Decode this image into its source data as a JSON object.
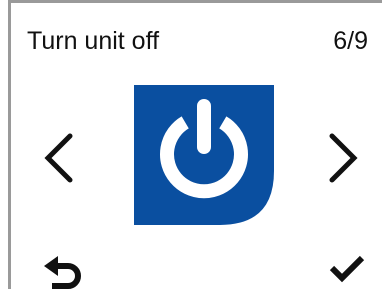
{
  "screen": {
    "title": "Turn unit off",
    "page_counter": "6/9"
  },
  "icons": {
    "prev": "chevron-left-icon",
    "next": "chevron-right-icon",
    "action": "power-icon",
    "back": "return-arrow-icon",
    "confirm": "checkmark-icon"
  },
  "colors": {
    "accent": "#0a4fa0",
    "icon": "#111111",
    "frame": "#9a9a9a"
  }
}
